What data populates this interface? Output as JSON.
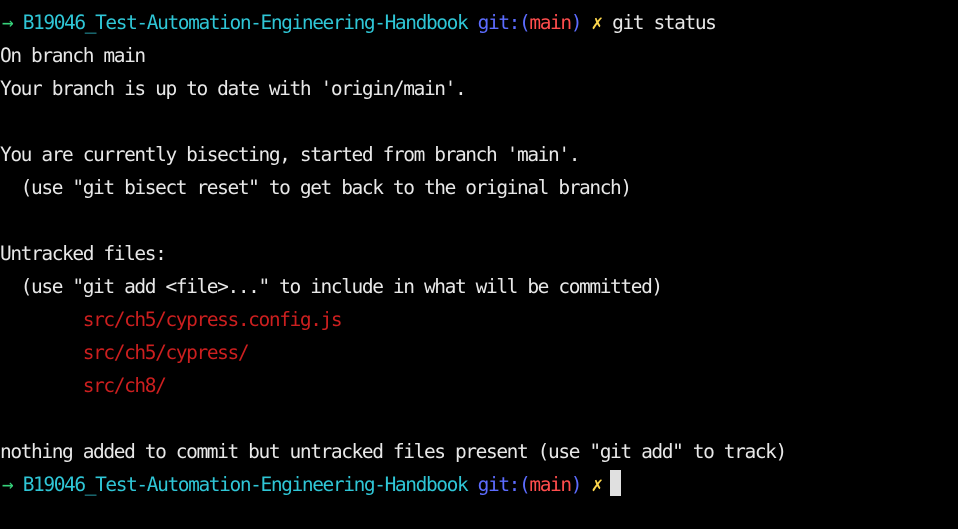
{
  "terminal": {
    "prompt": {
      "arrow": "→",
      "directory": "B19046_Test-Automation-Engineering-Handbook",
      "git_label": "git:(",
      "branch": "main",
      "git_close": ")",
      "dirty_marker": "✗"
    },
    "command": "git status",
    "output": {
      "on_branch": "On branch main",
      "up_to_date": "Your branch is up to date with 'origin/main'.",
      "bisecting": "You are currently bisecting, started from branch 'main'.",
      "bisect_hint": "  (use \"git bisect reset\" to get back to the original branch)",
      "untracked_header": "Untracked files:",
      "untracked_hint": "  (use \"git add <file>...\" to include in what will be committed)",
      "untracked_files": [
        "src/ch5/cypress.config.js",
        "src/ch5/cypress/",
        "src/ch8/"
      ],
      "summary": "nothing added to commit but untracked files present (use \"git add\" to track)"
    },
    "colors": {
      "background": "#000000",
      "text": "#e8e8e8",
      "arrow": "#36d17a",
      "directory": "#2fc6d6",
      "git_label": "#5c6cff",
      "branch": "#ff4d4d",
      "dirty_marker": "#ffd84d",
      "untracked_file": "#cc1f1f"
    }
  }
}
